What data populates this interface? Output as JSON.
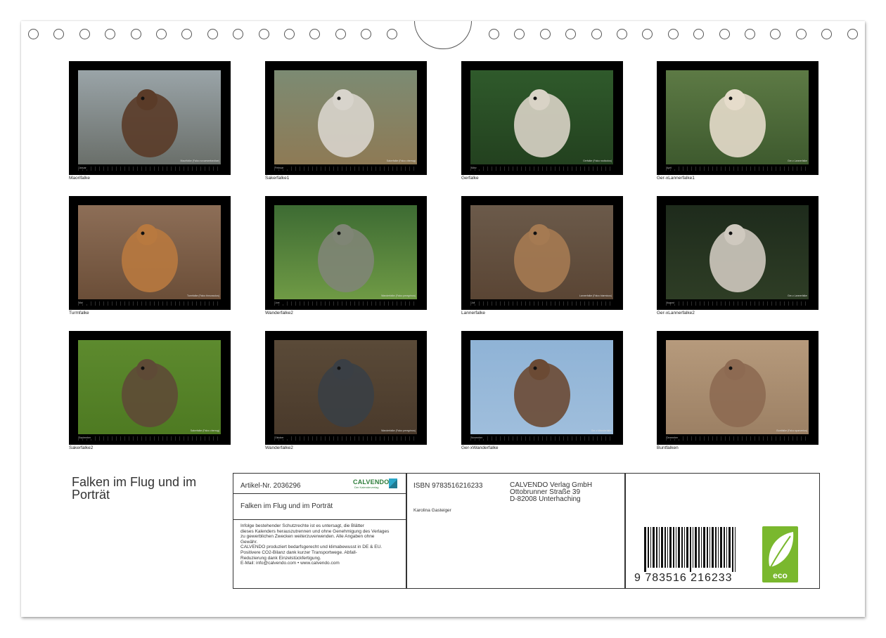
{
  "photos": [
    {
      "caption": "Maorifalke",
      "credit": "Maorifalke (Falco novaeseelandiae)",
      "month": "Januar",
      "sky": "#9aa4a8",
      "ground": "#6a6f6a",
      "bird": "#5a3b28"
    },
    {
      "caption": "Sakerfalke1",
      "credit": "Sakerfalke (Falco cherrug)",
      "month": "Februar",
      "sky": "#7c8b73",
      "ground": "#8e7a55",
      "bird": "#d8d4cc"
    },
    {
      "caption": "Gerfalke",
      "credit": "Gerfalke (Falco rusticolus)",
      "month": "März",
      "sky": "#2f5a2b",
      "ground": "#23411f",
      "bird": "#d9d3c6"
    },
    {
      "caption": "Ger-xLannerfalke1",
      "credit": "Ger-x Lannerfalke",
      "month": "April",
      "sky": "#5d7a45",
      "ground": "#3e5a2e",
      "bird": "#e6dccb"
    },
    {
      "caption": "Turmfalke",
      "credit": "Turmfalke (Falco tinnunculus)",
      "month": "Mai",
      "sky": "#8d6e57",
      "ground": "#6b4e38",
      "bird": "#b8793f"
    },
    {
      "caption": "Wanderfalke2",
      "credit": "Wanderfalke (Falco peregrinus)",
      "month": "Juni",
      "sky": "#3d6b33",
      "ground": "#6f9a45",
      "bird": "#7f8575"
    },
    {
      "caption": "Lannerfalke",
      "credit": "Lannerfalke (Falco biarmicus)",
      "month": "Juli",
      "sky": "#6b5a4a",
      "ground": "#5a4534",
      "bird": "#a57a52"
    },
    {
      "caption": "Ger-xLannerfalke2",
      "credit": "Ger-x Lannerfalke",
      "month": "August",
      "sky": "#1e2b1c",
      "ground": "#2e3d25",
      "bird": "#cfc9bf"
    },
    {
      "caption": "Sakerfalke2",
      "credit": "Sakerfalke (Falco cherrug)",
      "month": "September",
      "sky": "#5d8a2e",
      "ground": "#4e7a22",
      "bird": "#5e4a36"
    },
    {
      "caption": "Wanderfalke2",
      "credit": "Wanderfalke (Falco peregrinus)",
      "month": "Oktober",
      "sky": "#5a4a38",
      "ground": "#4a3a2b",
      "bird": "#3a3f45"
    },
    {
      "caption": "Ger-xWanderfalke",
      "credit": "Ger-x Wanderfalke",
      "month": "November",
      "sky": "#8fb3d6",
      "ground": "#9fbedc",
      "bird": "#6b4a34"
    },
    {
      "caption": "Buntfalken",
      "credit": "Buntfalke (Falco sparverius)",
      "month": "Dezember",
      "sky": "#b69a7c",
      "ground": "#9c8064",
      "bird": "#8d6a52"
    }
  ],
  "title": "Falken im Flug und im Porträt",
  "info": {
    "article": "Artikel-Nr. 2036296",
    "brand": "CALVENDO",
    "brand_sub": "Der Kalenderverlag",
    "cover_title": "Falken im Flug und im Porträt",
    "legal": [
      "Infolge bestehender Schutzrechte ist es untersagt, die Blätter",
      "dieses Kalenders herauszutrennen und ohne Genehmigung des Verlages",
      "zu gewerblichen Zwecken weiterzuverwenden. Alle Angaben ohne",
      "Gewähr.",
      "CALVENDO produziert bedarfsgerecht und klimabewusst in DE & EU.",
      "Positivere CO2-Bilanz dank kurzer Transportwege. Abfall-",
      "Reduzierung dank Einzelstückfertigung.",
      "E-Mail: info@calvendo.com • www.calvendo.com"
    ],
    "isbn": "ISBN 9783516216233",
    "publisher": [
      "CALVENDO Verlag GmbH",
      "Ottobrunner Straße 39",
      "D-82008 Unterhaching"
    ],
    "author": "Karolina Gasteiger",
    "barcode_number": "9   783516   216233",
    "eco": "eco"
  }
}
